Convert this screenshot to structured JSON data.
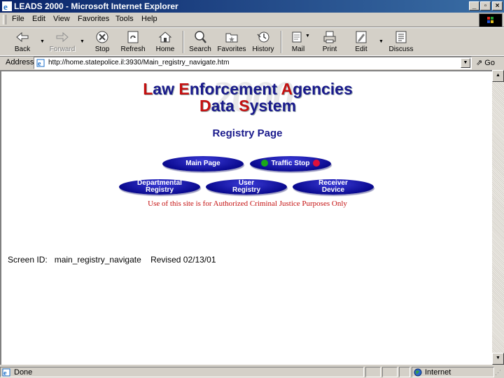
{
  "window": {
    "title": "LEADS 2000 - Microsoft Internet Explorer",
    "minimize": "_",
    "maximize": "▫",
    "close": "×"
  },
  "menu": [
    "File",
    "Edit",
    "View",
    "Favorites",
    "Tools",
    "Help"
  ],
  "toolbar": {
    "back": "Back",
    "forward": "Forward",
    "stop": "Stop",
    "refresh": "Refresh",
    "home": "Home",
    "search": "Search",
    "favorites": "Favorites",
    "history": "History",
    "mail": "Mail",
    "print": "Print",
    "edit": "Edit",
    "discuss": "Discuss"
  },
  "address": {
    "label": "Address",
    "url": "http://home.statepolice.il:3930/Main_registry_navigate.htm",
    "go": "Go"
  },
  "page": {
    "logo": {
      "line1_a": "L",
      "line1_b": "aw ",
      "line1_c": "E",
      "line1_d": "nforcement ",
      "line1_e": "A",
      "line1_f": "gencies",
      "line2_a": "D",
      "line2_b": "ata ",
      "line2_c": "S",
      "line2_d": "ystem",
      "watermark": "2000"
    },
    "heading": "Registry Page",
    "buttons": {
      "main_page": "Main Page",
      "traffic_stop": "Traffic Stop",
      "departmental_1": "Departmental",
      "departmental_2": "Registry",
      "user_1": "User",
      "user_2": "Registry",
      "receiver_1": "Receiver",
      "receiver_2": "Device"
    },
    "notice": "Use of this site is for Authorized Criminal Justice Purposes Only",
    "screen_id": "Screen ID:   main_registry_navigate    Revised 02/13/01"
  },
  "status": {
    "text": "Done",
    "zone": "Internet"
  },
  "colors": {
    "accent": "#1a1a8c",
    "red": "#c41010",
    "green_dot": "#1aa81a",
    "red_dot": "#e0103a"
  }
}
